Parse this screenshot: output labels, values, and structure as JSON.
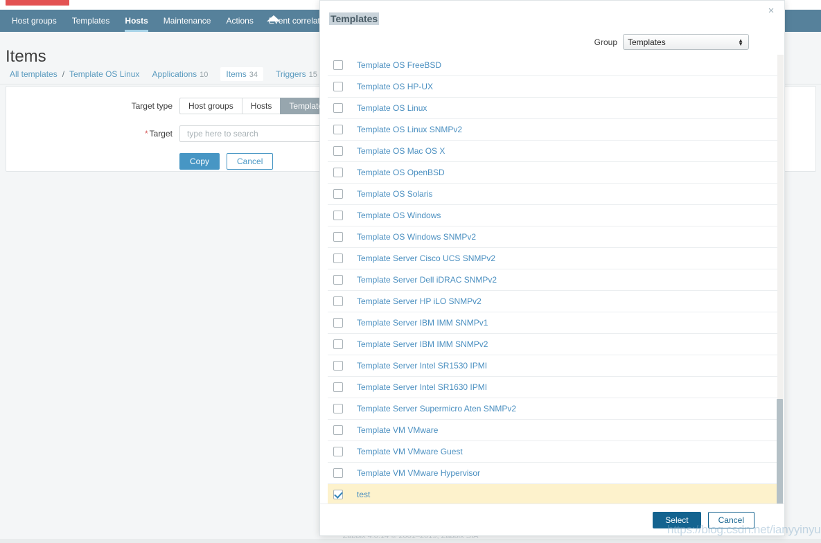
{
  "app": {
    "logo": "zabbix-logo",
    "footer": "Zabbix 4.0.14 © 2001–2019, Zabbix SIA",
    "watermark": "https://blog.csdn.net/ianyyinyu"
  },
  "nav": {
    "items": [
      {
        "label": "Host groups",
        "active": false
      },
      {
        "label": "Templates",
        "active": false
      },
      {
        "label": "Hosts",
        "active": true
      },
      {
        "label": "Maintenance",
        "active": false
      },
      {
        "label": "Actions",
        "active": false
      },
      {
        "label": "Event correlation",
        "active": false
      }
    ]
  },
  "page": {
    "title": "Items",
    "breadcrumb": {
      "root": "All templates",
      "separator": "/",
      "current": "Template OS Linux",
      "tabs": [
        {
          "label": "Applications",
          "count": "10",
          "selected": false
        },
        {
          "label": "Items",
          "count": "34",
          "selected": true
        },
        {
          "label": "Triggers",
          "count": "15",
          "selected": false
        }
      ]
    }
  },
  "form": {
    "target_type_label": "Target type",
    "target_type_options": [
      {
        "label": "Host groups",
        "active": false
      },
      {
        "label": "Hosts",
        "active": false
      },
      {
        "label": "Templates",
        "active": true
      }
    ],
    "target_label": "Target",
    "target_required_mark": "*",
    "target_value": "",
    "target_placeholder": "type here to search",
    "copy_label": "Copy",
    "cancel_label": "Cancel"
  },
  "modal": {
    "title": "Templates",
    "close_label": "×",
    "group_label": "Group",
    "group_value": "Templates",
    "select_label": "Select",
    "cancel_label": "Cancel",
    "rows": [
      {
        "label": "Template OS FreeBSD",
        "checked": false
      },
      {
        "label": "Template OS HP-UX",
        "checked": false
      },
      {
        "label": "Template OS Linux",
        "checked": false
      },
      {
        "label": "Template OS Linux SNMPv2",
        "checked": false
      },
      {
        "label": "Template OS Mac OS X",
        "checked": false
      },
      {
        "label": "Template OS OpenBSD",
        "checked": false
      },
      {
        "label": "Template OS Solaris",
        "checked": false
      },
      {
        "label": "Template OS Windows",
        "checked": false
      },
      {
        "label": "Template OS Windows SNMPv2",
        "checked": false
      },
      {
        "label": "Template Server Cisco UCS SNMPv2",
        "checked": false
      },
      {
        "label": "Template Server Dell iDRAC SNMPv2",
        "checked": false
      },
      {
        "label": "Template Server HP iLO SNMPv2",
        "checked": false
      },
      {
        "label": "Template Server IBM IMM SNMPv1",
        "checked": false
      },
      {
        "label": "Template Server IBM IMM SNMPv2",
        "checked": false
      },
      {
        "label": "Template Server Intel SR1530 IPMI",
        "checked": false
      },
      {
        "label": "Template Server Intel SR1630 IPMI",
        "checked": false
      },
      {
        "label": "Template Server Supermicro Aten SNMPv2",
        "checked": false
      },
      {
        "label": "Template VM VMware",
        "checked": false
      },
      {
        "label": "Template VM VMware Guest",
        "checked": false
      },
      {
        "label": "Template VM VMware Hypervisor",
        "checked": false
      },
      {
        "label": "test",
        "checked": true
      }
    ]
  },
  "colors": {
    "nav_bg": "#56819b",
    "link": "#4a8fc0",
    "primary_button": "#4796c4",
    "modal_primary_button": "#14638f",
    "selected_row": "#fdf2cc",
    "logo": "#e35252"
  }
}
